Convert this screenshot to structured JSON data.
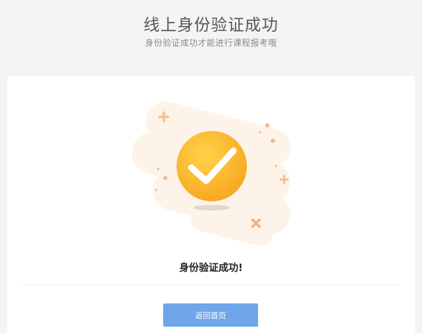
{
  "header": {
    "title": "线上身份验证成功",
    "subtitle": "身份验证成功才能进行课程报考哦"
  },
  "result": {
    "message": "身份验证成功!",
    "status_icon": "check-circle-icon"
  },
  "actions": {
    "home_button_label": "返回首页"
  },
  "colors": {
    "background": "#f4f4f4",
    "card": "#ffffff",
    "accent_orange": "#fbb22f",
    "button_blue": "#6ea6e9"
  }
}
